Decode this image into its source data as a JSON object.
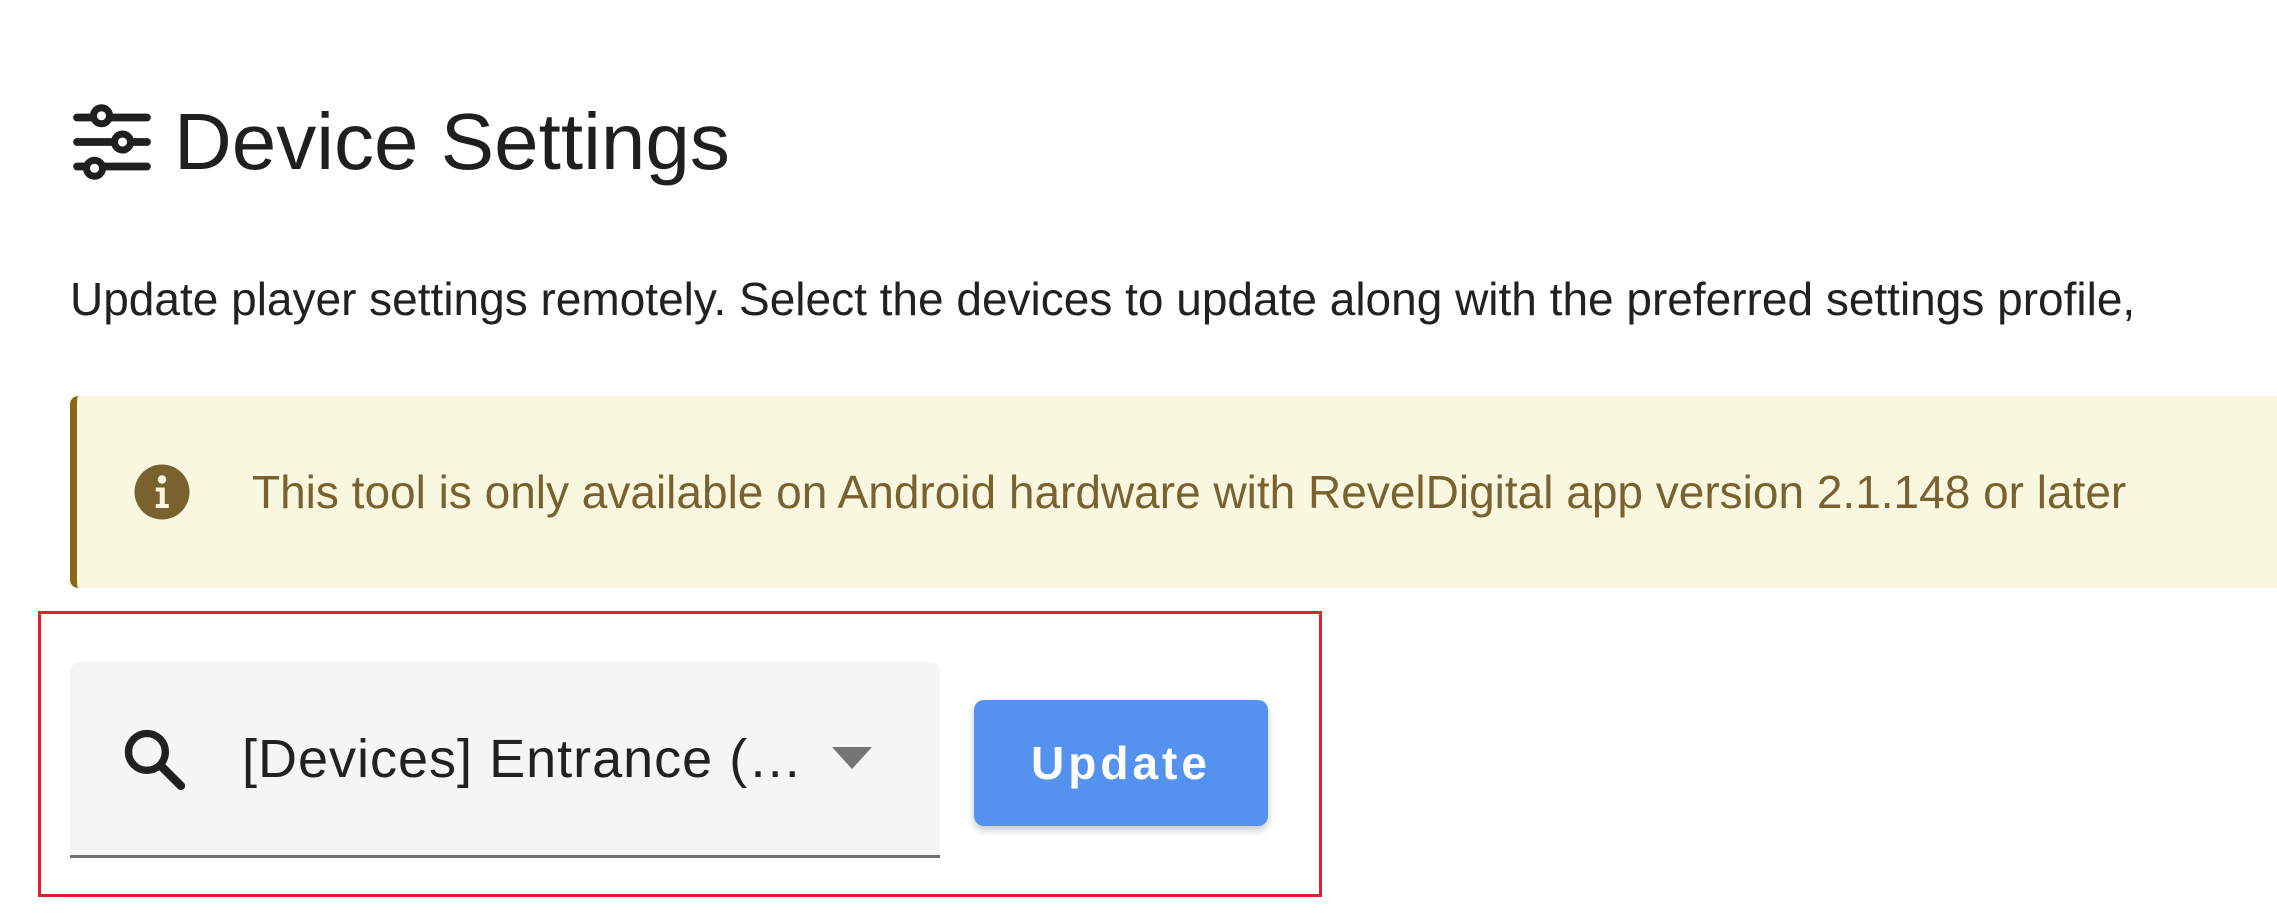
{
  "header": {
    "title": "Device Settings",
    "icon": "sliders-icon"
  },
  "description": "Update player settings remotely. Select the devices to update along with the preferred settings profile,",
  "alert": {
    "icon": "info-icon",
    "text": "This tool is only available on Android hardware with RevelDigital app version 2.1.148 or later",
    "background_color": "#f9f7e0",
    "accent_color": "#8b6914"
  },
  "device_select": {
    "icon": "search-icon",
    "value": "[Devices] Entrance (…",
    "dropdown_icon": "chevron-down-icon"
  },
  "update_button": {
    "label": "Update",
    "color": "#5592ef"
  },
  "highlight_color": "#e0202e"
}
